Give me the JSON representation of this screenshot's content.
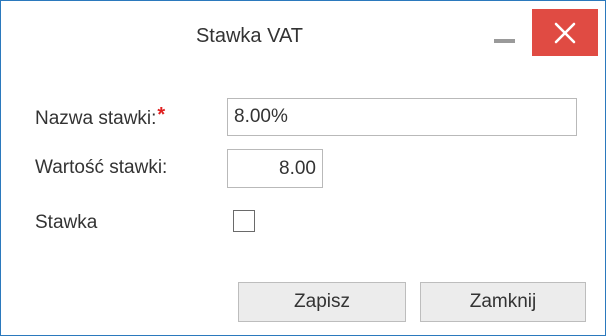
{
  "dialog": {
    "title": "Stawka VAT",
    "minimize_icon": "minimize-icon",
    "close_icon": "close-icon",
    "close_color": "#e04b43"
  },
  "form": {
    "name_label": "Nazwa stawki:",
    "name_required_mark": "*",
    "name_value": "8.00%",
    "value_label": "Wartość stawki:",
    "value_value": "8.00",
    "rate_label": "Stawka",
    "rate_checked": false
  },
  "buttons": {
    "save_label": "Zapisz",
    "close_label": "Zamknij"
  }
}
